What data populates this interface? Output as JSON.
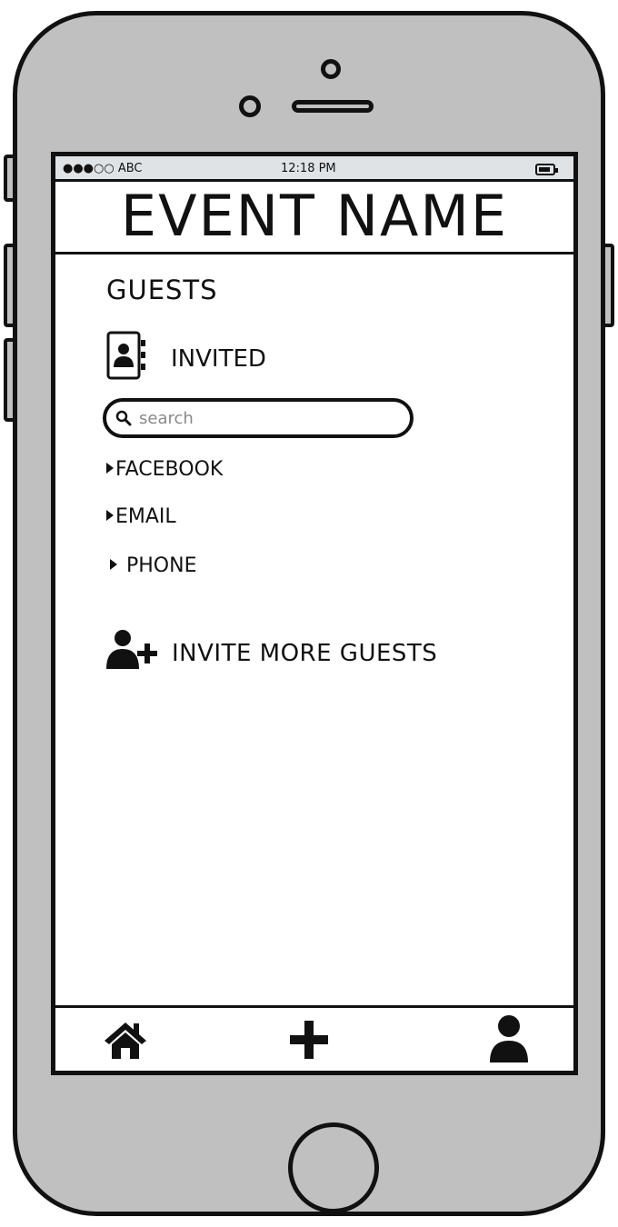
{
  "status_bar": {
    "carrier": "●●●○○ ABC",
    "time": "12:18 PM"
  },
  "header": {
    "title": "EVENT NAME"
  },
  "guests": {
    "section_title": "GUESTS",
    "invited_label": "INVITED",
    "search": {
      "placeholder": "search",
      "value": ""
    },
    "sources": [
      {
        "label": "FACEBOOK"
      },
      {
        "label": "EMAIL"
      },
      {
        "label": "PHONE"
      }
    ],
    "invite_more_label": "INVITE MORE GUESTS"
  },
  "tab_bar": {
    "icons": [
      "home-icon",
      "add-icon",
      "profile-icon"
    ]
  },
  "colors": {
    "device_body": "#c0c0c0",
    "status_bar_bg": "#dfe3e6",
    "ink": "#111111"
  }
}
